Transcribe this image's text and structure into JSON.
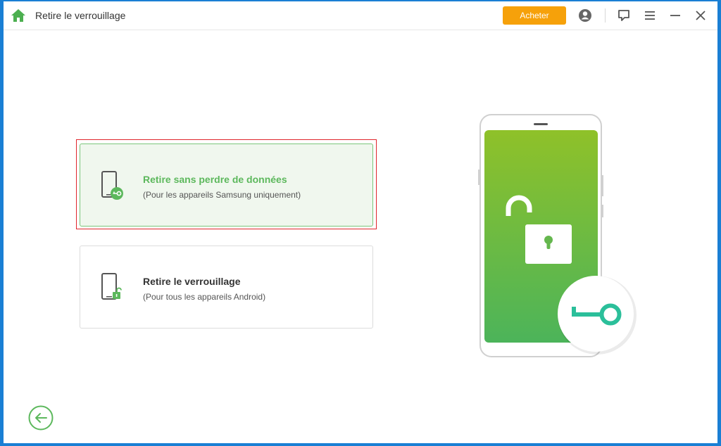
{
  "titlebar": {
    "title": "Retire le verrouillage",
    "buy_label": "Acheter"
  },
  "options": [
    {
      "title": "Retire sans perdre de données",
      "subtitle": "(Pour les appareils Samsung uniquement)",
      "selected": true
    },
    {
      "title": "Retire le verrouillage",
      "subtitle": "(Pour tous les appareils Android)",
      "selected": false
    }
  ],
  "icons": {
    "home": "home-icon",
    "account": "account-icon",
    "feedback": "feedback-icon",
    "menu": "menu-icon",
    "minimize": "minimize-icon",
    "close": "close-icon",
    "back": "back-arrow-icon"
  },
  "colors": {
    "accent_green": "#5cb85c",
    "buy_orange": "#f6a10a",
    "selection_red": "#e0252b",
    "key_teal": "#2bbf9a"
  }
}
